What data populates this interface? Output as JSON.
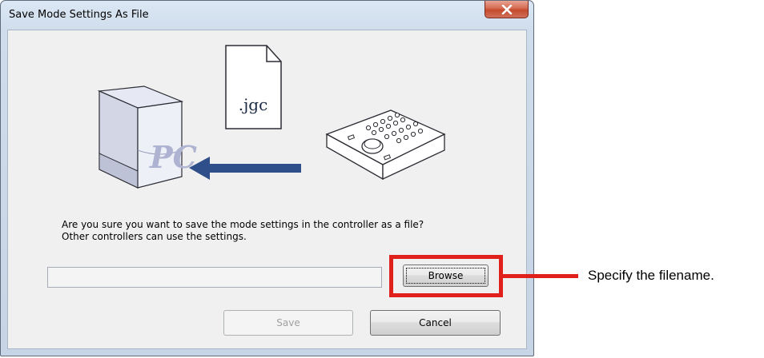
{
  "window": {
    "title": "Save Mode Settings As File",
    "close_symbol": "X"
  },
  "illustration": {
    "pc_label": "PC",
    "file_label": ".jgc",
    "icons": [
      "pc-icon",
      "file-icon",
      "arrow-left-icon",
      "controller-icon"
    ]
  },
  "message": {
    "line1": "Are you sure you want to save the mode settings in the controller as a file?",
    "line2": "Other controllers can use the settings."
  },
  "filename_field": {
    "value": "",
    "placeholder": ""
  },
  "buttons": {
    "browse": "Browse",
    "save": "Save",
    "cancel": "Cancel"
  },
  "callout": {
    "text": "Specify the filename.",
    "color": "#e0201b"
  }
}
